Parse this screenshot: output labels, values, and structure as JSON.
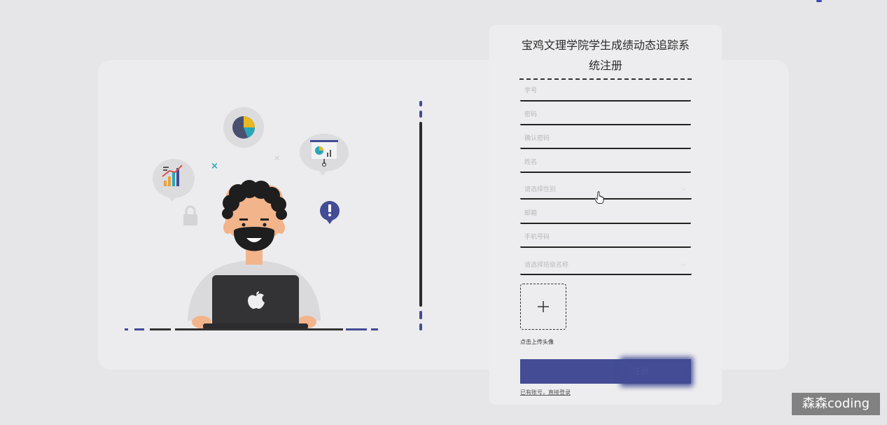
{
  "form": {
    "title": "宝鸡文理学院学生成绩动态追踪系统注册",
    "fields": {
      "student_id": "学号",
      "password": "密码",
      "confirm_password": "确认密码",
      "name": "姓名",
      "gender": "请选择性别",
      "email": "邮箱",
      "phone": "手机号码",
      "class_name": "请选择班级名称"
    },
    "upload_label": "点击上传头像",
    "submit_label": "注册",
    "login_link": "已有账号，直接登录"
  },
  "watermark": "森森coding",
  "colors": {
    "accent": "#434c94",
    "background": "#e6e6e8",
    "card": "#ededef"
  }
}
